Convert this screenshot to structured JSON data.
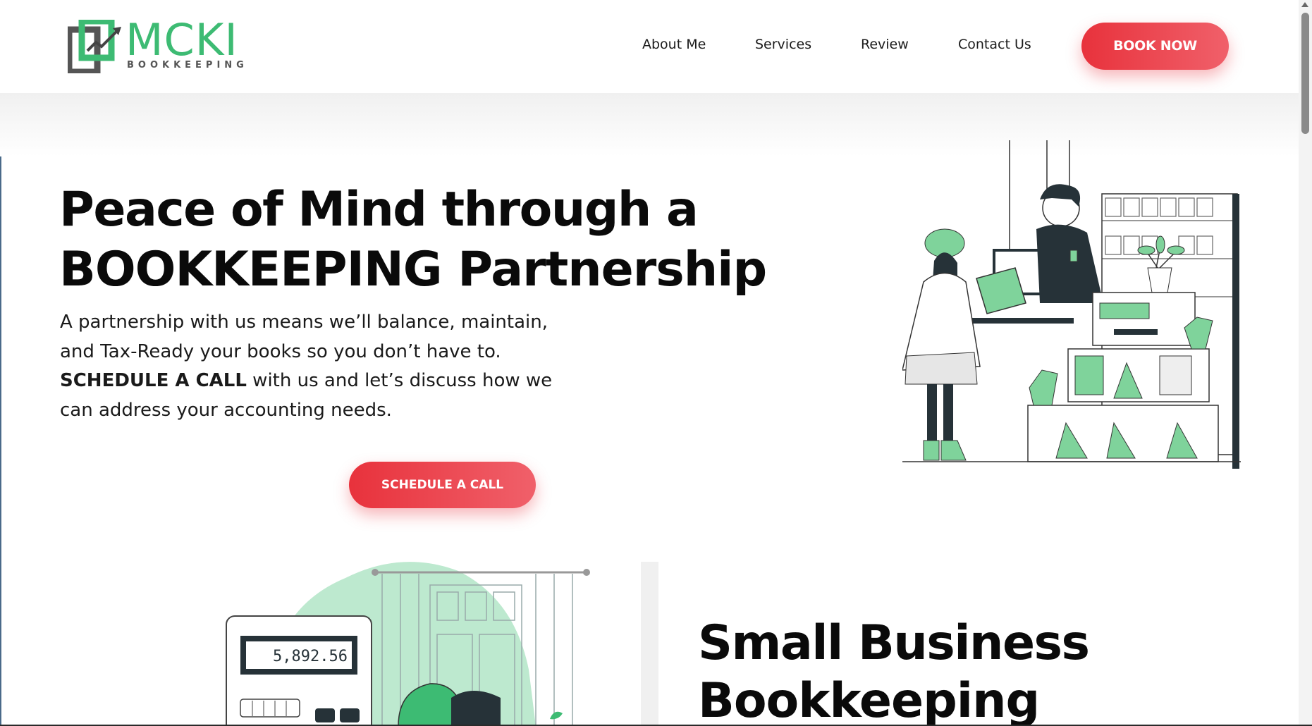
{
  "brand": {
    "name": "MCKI",
    "tagline": "BOOKKEEPING",
    "green": "#3dbb73",
    "red": "#e8323c"
  },
  "nav": {
    "about": "About Me",
    "services": "Services",
    "review": "Review",
    "contact": "Contact Us",
    "cta": "BOOK NOW"
  },
  "hero": {
    "title_bold": "Peace of Mind through a",
    "title_light": "BOOKKEEPING Partnership",
    "body_part1": "A partnership with us means we’ll balance, maintain, and Tax-Ready your books so you don’t have to. ",
    "body_bold": "SCHEDULE A CALL",
    "body_part2": " with us and let’s discuss how we can address your accounting needs.",
    "cta": "SCHEDULE A CALL"
  },
  "section2": {
    "calculator_display": "5,892.56",
    "title_bold": "Small Business",
    "title_light": "Bookkeeping"
  },
  "icons": {
    "logo": "mcki-logo-icon",
    "scroll_up": "chevron-up-icon"
  }
}
